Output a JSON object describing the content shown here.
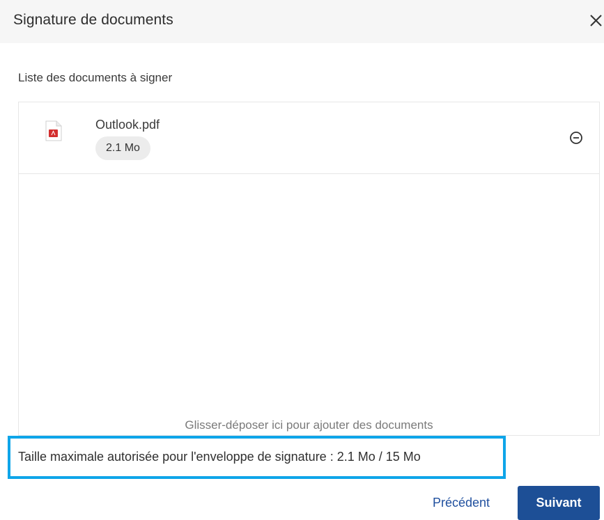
{
  "dialog": {
    "title": "Signature de documents",
    "close_icon": "close-icon"
  },
  "documents": {
    "section_label": "Liste des documents à signer",
    "items": [
      {
        "name": "Outlook.pdf",
        "size": "2.1 Mo",
        "file_icon": "pdf-file-icon",
        "remove_icon": "remove-circle-icon"
      }
    ],
    "drop_hint": "Glisser-déposer ici pour ajouter des documents"
  },
  "quota": {
    "text": "Taille maximale autorisée pour l'enveloppe de signature : 2.1 Mo / 15 Mo",
    "used_mo": 2.1,
    "max_mo": 15,
    "highlight_color": "#0ea5e9"
  },
  "actions": {
    "previous_label": "Précédent",
    "next_label": "Suivant"
  },
  "colors": {
    "primary": "#1d4f96",
    "link": "#1f4f9e",
    "pdf_red": "#d32f2f"
  }
}
